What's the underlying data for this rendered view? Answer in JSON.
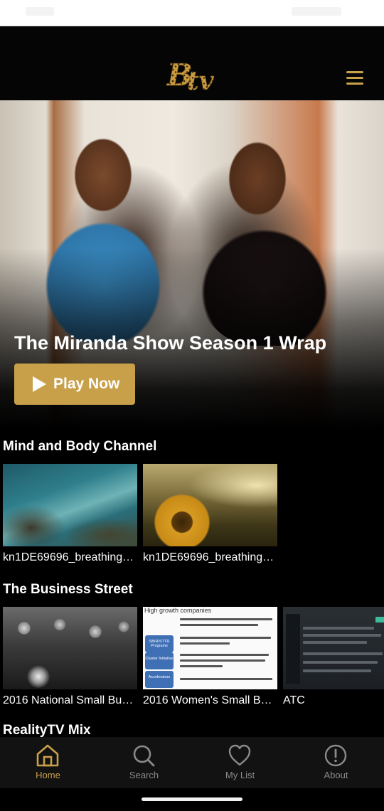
{
  "app": {
    "brand": "BTV",
    "accent_color": "#c9a04a",
    "menu_icon": "hamburger-menu-icon"
  },
  "hero": {
    "title": "The Miranda Show Season 1 Wrap",
    "play_label": "Play Now",
    "play_icon": "play-icon"
  },
  "rows": [
    {
      "title": "Mind and Body Channel",
      "items": [
        {
          "caption": "kn1DE69696_breathing_..."
        },
        {
          "caption": "kn1DE69696_breathing_..."
        }
      ]
    },
    {
      "title": "The Business Street",
      "items": [
        {
          "caption": "2016 National Small Busi..."
        },
        {
          "caption": "2016 Women's Small Bus..."
        },
        {
          "caption": "ATC"
        }
      ],
      "slide_header": "High growth companies",
      "slide_boxes": [
        "SBIR/STTR Programs",
        "Cluster Initiative",
        "Accelerators"
      ]
    },
    {
      "title": "RealityTV Mix"
    }
  ],
  "nav": [
    {
      "label": "Home",
      "icon": "home-icon",
      "active": true
    },
    {
      "label": "Search",
      "icon": "search-icon",
      "active": false
    },
    {
      "label": "My List",
      "icon": "heart-icon",
      "active": false
    },
    {
      "label": "About",
      "icon": "info-icon",
      "active": false
    }
  ]
}
